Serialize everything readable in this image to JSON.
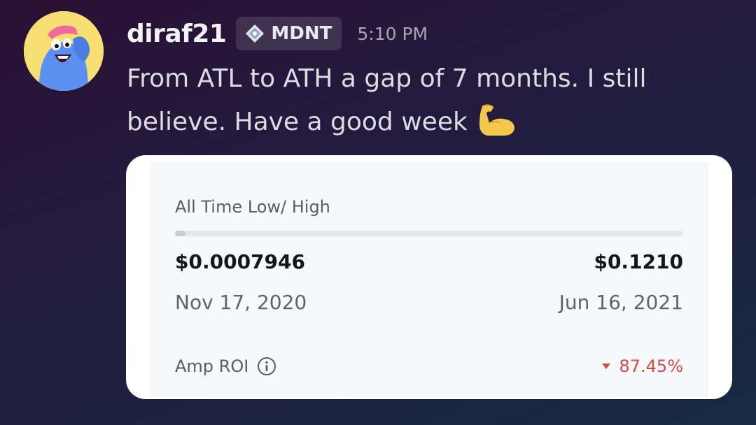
{
  "message": {
    "username": "diraf21",
    "tag": {
      "label": "MDNT",
      "icon": "diamond-badge-icon"
    },
    "timestamp": "5:10 PM",
    "text": "From ATL to ATH a gap of 7 months. I still believe. Have a good week",
    "emoji": "flexed-biceps-icon"
  },
  "card": {
    "title": "All Time Low/ High",
    "range_fraction": 0.02,
    "low": {
      "price": "$0.0007946",
      "date": "Nov 17, 2020"
    },
    "high": {
      "price": "$0.1210",
      "date": "Jun 16, 2021"
    },
    "roi": {
      "label": "Amp ROI",
      "value": "87.45%",
      "direction": "down",
      "color": "#d44b4b"
    }
  }
}
